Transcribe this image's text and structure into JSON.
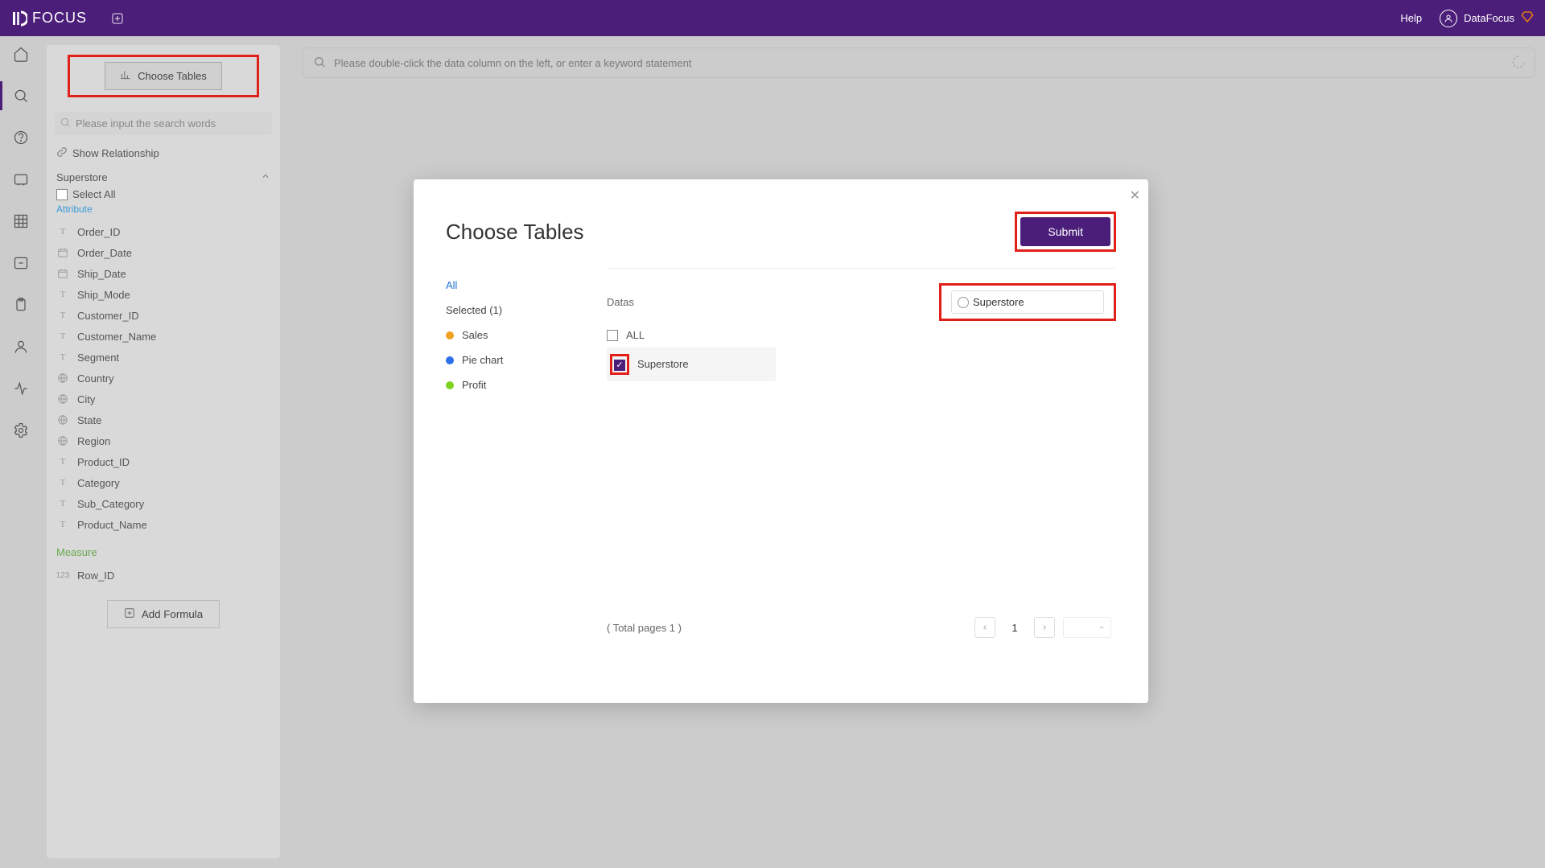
{
  "topbar": {
    "logo_text": "FOCUS",
    "help": "Help",
    "user": "DataFocus"
  },
  "mainsearch": {
    "placeholder": "Please double-click the data column on the left, or enter a keyword statement"
  },
  "leftpanel": {
    "choose_tables": "Choose Tables",
    "search_placeholder": "Please input the search words",
    "show_relationship": "Show Relationship",
    "group_title": "Superstore",
    "select_all": "Select All",
    "attribute_label": "Attribute",
    "measure_label": "Measure",
    "add_formula": "Add Formula",
    "attributes": [
      {
        "type": "T",
        "name": "Order_ID"
      },
      {
        "type": "D",
        "name": "Order_Date"
      },
      {
        "type": "D",
        "name": "Ship_Date"
      },
      {
        "type": "T",
        "name": "Ship_Mode"
      },
      {
        "type": "T",
        "name": "Customer_ID"
      },
      {
        "type": "T",
        "name": "Customer_Name"
      },
      {
        "type": "T",
        "name": "Segment"
      },
      {
        "type": "G",
        "name": "Country"
      },
      {
        "type": "G",
        "name": "City"
      },
      {
        "type": "G",
        "name": "State"
      },
      {
        "type": "G",
        "name": "Region"
      },
      {
        "type": "T",
        "name": "Product_ID"
      },
      {
        "type": "T",
        "name": "Category"
      },
      {
        "type": "T",
        "name": "Sub_Category"
      },
      {
        "type": "T",
        "name": "Product_Name"
      }
    ],
    "measures": [
      {
        "type": "123",
        "name": "Row_ID"
      }
    ]
  },
  "modal": {
    "title": "Choose Tables",
    "submit": "Submit",
    "filter_all": "All",
    "filter_selected": "Selected (1)",
    "filter_items": [
      {
        "color": "orange",
        "label": "Sales"
      },
      {
        "color": "blue",
        "label": "Pie chart"
      },
      {
        "color": "green",
        "label": "Profit"
      }
    ],
    "datas_label": "Datas",
    "search_value": "Superstore",
    "all_label": "ALL",
    "rows": [
      {
        "checked": true,
        "name": "Superstore"
      }
    ],
    "pager_text": "( Total pages 1 )",
    "page_num": "1"
  }
}
